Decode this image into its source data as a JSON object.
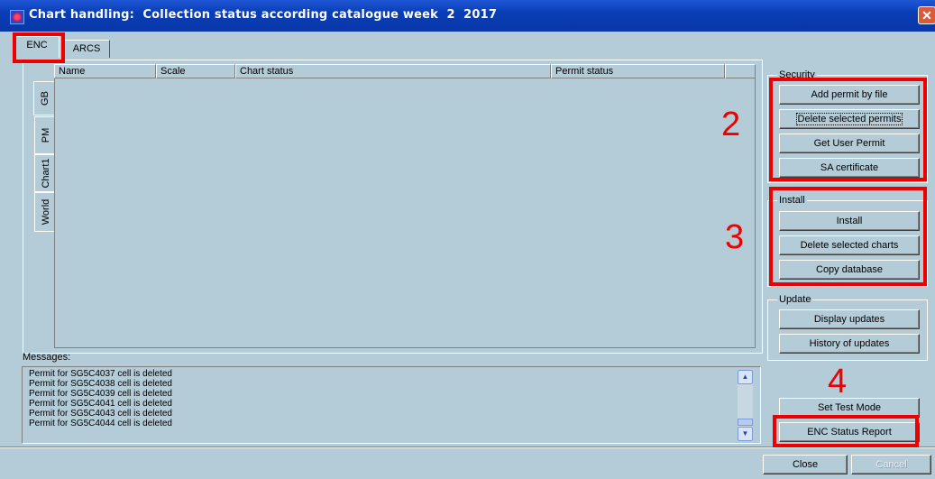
{
  "window": {
    "title": "Chart handling:  Collection status according catalogue week  2  2017",
    "close_glyph": "✕"
  },
  "tabs": [
    {
      "label": "ENC"
    },
    {
      "label": "ARCS"
    }
  ],
  "side_tabs": [
    {
      "label": "GB"
    },
    {
      "label": "PM"
    },
    {
      "label": "Chart1"
    },
    {
      "label": "World"
    }
  ],
  "table": {
    "columns": [
      "Name",
      "Scale",
      "Chart status",
      "Permit status"
    ]
  },
  "security": {
    "label": "Security",
    "buttons": [
      "Add permit by file",
      "Delete selected permits",
      "Get User Permit",
      "SA certificate"
    ]
  },
  "install": {
    "label": "Install",
    "buttons": [
      "Install",
      "Delete selected charts",
      "Copy database"
    ]
  },
  "update": {
    "label": "Update",
    "buttons": [
      "Display updates",
      "History of updates"
    ]
  },
  "actions": {
    "test_mode": "Set Test Mode",
    "status_report": "ENC Status Report"
  },
  "messages": {
    "label": "Messages:",
    "lines": [
      "Permit for SG5C4037 cell is deleted",
      "Permit for SG5C4038 cell is deleted",
      "Permit for SG5C4039 cell is deleted",
      "Permit for SG5C4041 cell is deleted",
      "Permit for SG5C4043 cell is deleted",
      "Permit for SG5C4044 cell is deleted"
    ]
  },
  "footer": {
    "close": "Close",
    "cancel": "Cancel"
  },
  "annotations": [
    "2",
    "3",
    "4"
  ],
  "colors": {
    "highlight": "#e00000",
    "titlebar": "#0a3db5",
    "background": "#b4cbd8"
  }
}
